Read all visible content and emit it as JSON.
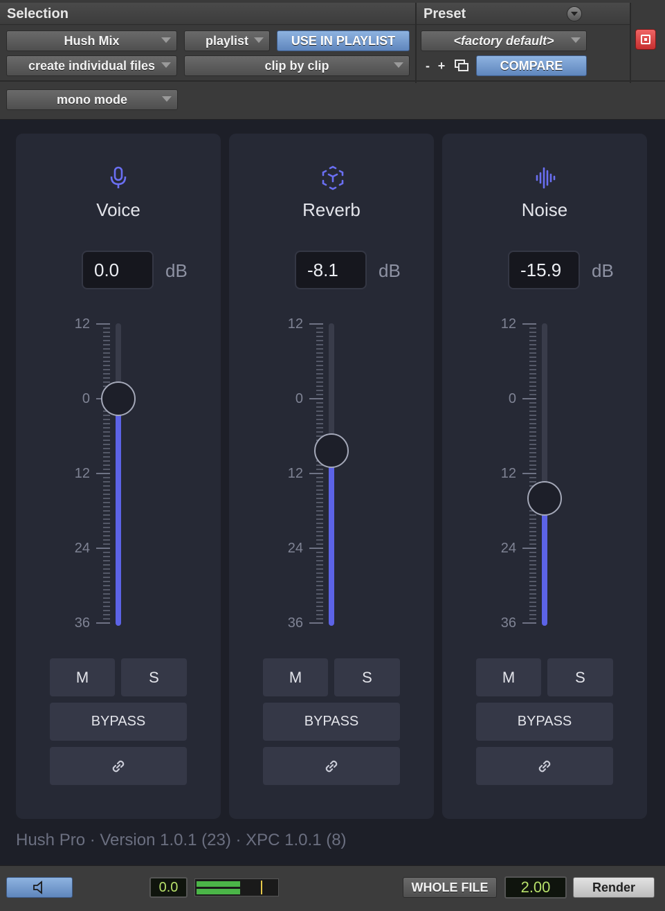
{
  "host_header": {
    "selection_title": "Selection",
    "preset_title": "Preset",
    "mix_dropdown": "Hush Mix",
    "playlist_dropdown": "playlist",
    "use_in_playlist": "USE IN PLAYLIST",
    "factory_default": "<factory default>",
    "create_files_dropdown": "create individual files",
    "clip_by_clip_dropdown": "clip by clip",
    "preset_minus": "-",
    "preset_plus": "+",
    "compare": "COMPARE",
    "mono_mode_dropdown": "mono mode"
  },
  "scale_labels": [
    "12",
    "0",
    "12",
    "24",
    "36"
  ],
  "channels": [
    {
      "name": "Voice",
      "icon": "microphone-icon",
      "value": "0.0",
      "unit": "dB",
      "level_fraction": 0.75,
      "mute": "M",
      "solo": "S",
      "bypass": "BYPASS",
      "link_icon": "link-icon"
    },
    {
      "name": "Reverb",
      "icon": "reverb-cube-icon",
      "value": "-8.1",
      "unit": "dB",
      "level_fraction": 0.58,
      "mute": "M",
      "solo": "S",
      "bypass": "BYPASS",
      "link_icon": "link-icon"
    },
    {
      "name": "Noise",
      "icon": "waveform-icon",
      "value": "-15.9",
      "unit": "dB",
      "level_fraction": 0.42,
      "mute": "M",
      "solo": "S",
      "bypass": "BYPASS",
      "link_icon": "link-icon"
    }
  ],
  "footer": {
    "version_text": "Hush Pro · Version 1.0.1 (23) · XPC 1.0.1 (8)"
  },
  "host_bottom": {
    "gain_value": "0.0",
    "whole_file": "WHOLE FILE",
    "handle_value": "2.00",
    "render": "Render"
  },
  "colors": {
    "accent": "#5c63e6",
    "panel": "#262935",
    "background": "#1d1f28",
    "pt_blue": "#7aa0d3",
    "lcd_green": "#b7e06a"
  }
}
